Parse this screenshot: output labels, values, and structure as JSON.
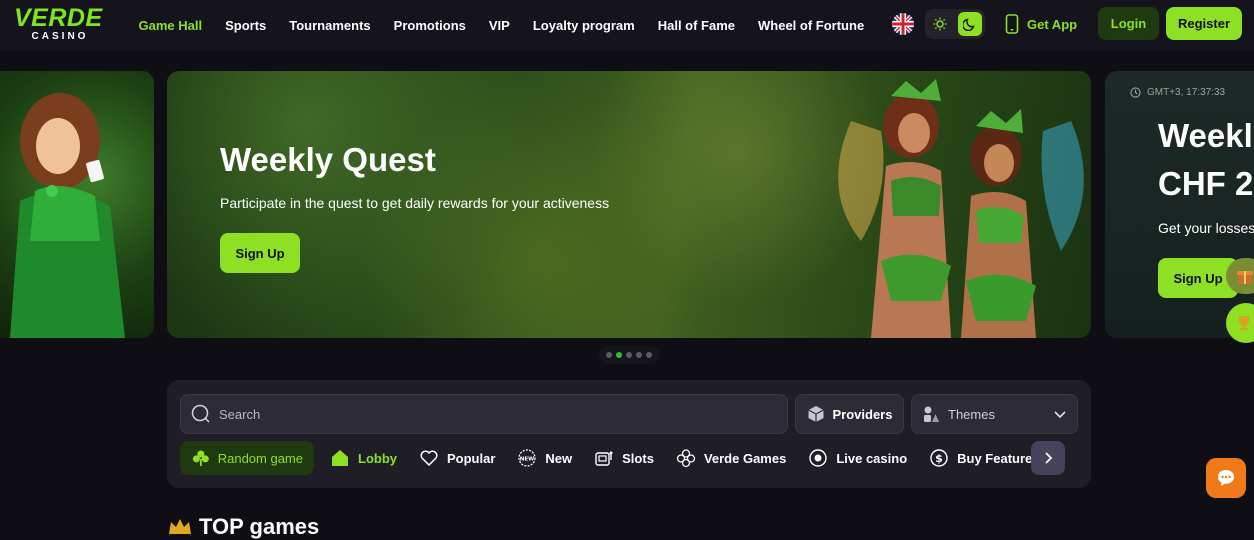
{
  "header": {
    "logo_main": "VERDE",
    "logo_sub": "CASINO",
    "nav": [
      "Game Hall",
      "Sports",
      "Tournaments",
      "Promotions",
      "VIP",
      "Loyalty program",
      "Hall of Fame",
      "Wheel of Fortune"
    ],
    "get_app": "Get App",
    "login": "Login",
    "register": "Register"
  },
  "banner_main": {
    "title": "Weekly Quest",
    "description": "Participate in the quest to get daily rewards for your activeness",
    "button": "Sign Up"
  },
  "banner_next": {
    "time": "GMT+3, 17:37:33",
    "title_line1": "Weekl",
    "title_line2": "CHF 2",
    "description": "Get your losses",
    "button": "Sign Up"
  },
  "carousel": {
    "dot_count": 5,
    "active_index": 1
  },
  "games": {
    "search_placeholder": "Search",
    "providers": "Providers",
    "themes": "Themes",
    "categories": [
      "Random game",
      "Lobby",
      "Popular",
      "New",
      "Slots",
      "Verde Games",
      "Live casino",
      "Buy Feature"
    ]
  },
  "section_title": "TOP games",
  "colors": {
    "accent": "#8ee024",
    "background": "#0f0e14",
    "panel": "#1f1e27",
    "chat": "#f07a1a"
  }
}
